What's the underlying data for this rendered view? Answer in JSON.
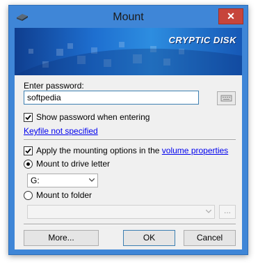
{
  "window": {
    "title": "Mount",
    "close_symbol": "✕"
  },
  "banner": {
    "brand": "CRYPTIC DISK"
  },
  "password": {
    "label": "Enter password:",
    "value": "softpedia",
    "show_checkbox_label": "Show password when entering",
    "show_checked": true
  },
  "keyfile": {
    "link": "Keyfile not specified"
  },
  "options": {
    "apply_label_prefix": "Apply the mounting options in the ",
    "apply_link": "volume properties",
    "apply_checked": true
  },
  "mount": {
    "drive_letter_label": "Mount to drive letter",
    "drive_letter_selected": true,
    "drive_letter_value": "G:",
    "folder_label": "Mount to folder",
    "folder_value": "",
    "browse_label": "..."
  },
  "buttons": {
    "more": "More...",
    "ok": "OK",
    "cancel": "Cancel"
  },
  "colors": {
    "window_frame": "#3f86d7",
    "close_button": "#c7453b",
    "link": "#0000ee"
  },
  "icons": {
    "app": "disk-icon",
    "keyboard": "keyboard-icon",
    "dropdown": "chevron-down-icon",
    "check": "checkmark-icon"
  }
}
